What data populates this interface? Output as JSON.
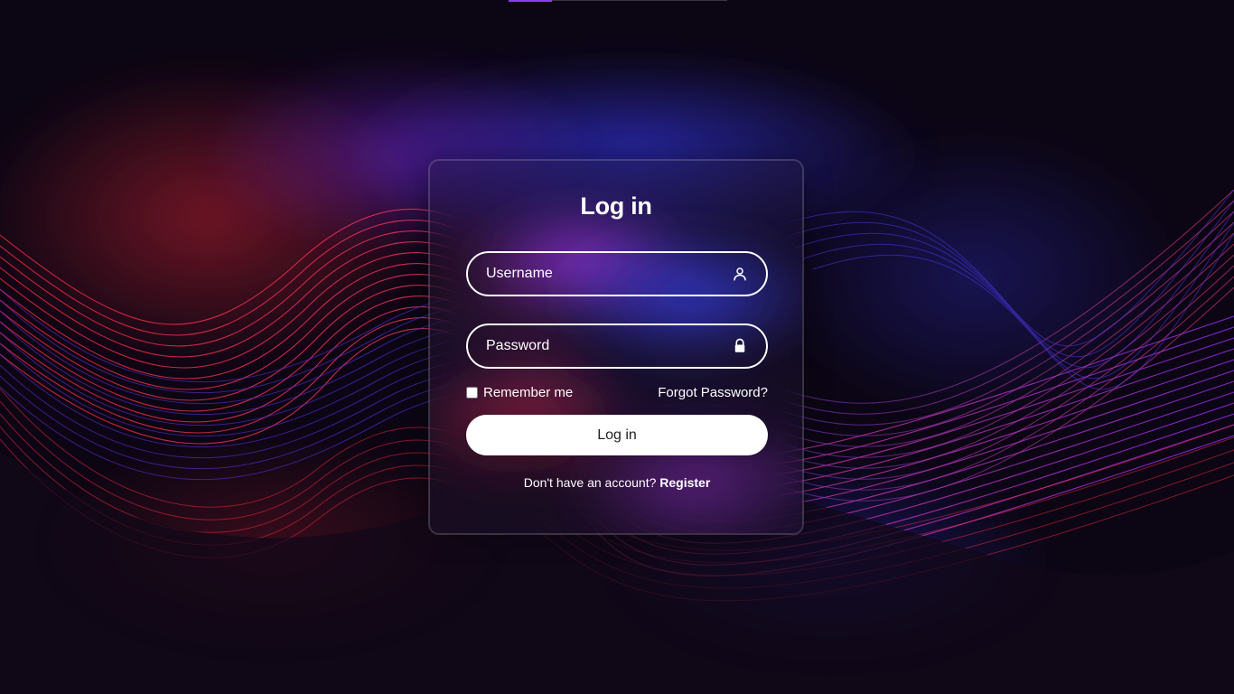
{
  "login": {
    "title": "Log in",
    "username_placeholder": "Username",
    "password_placeholder": "Password",
    "remember_label": "Remember me",
    "forgot_label": "Forgot Password?",
    "button_label": "Log in",
    "register_prompt": "Don't have an account?",
    "register_label": "Register"
  },
  "icons": {
    "username": "user-icon",
    "password": "lock-icon"
  },
  "colors": {
    "background": "#0c0614",
    "accent_red": "#ff2a3a",
    "accent_purple": "#8a3cf0",
    "accent_blue": "#3a36e8",
    "text": "#ffffff",
    "button_bg": "#ffffff"
  }
}
